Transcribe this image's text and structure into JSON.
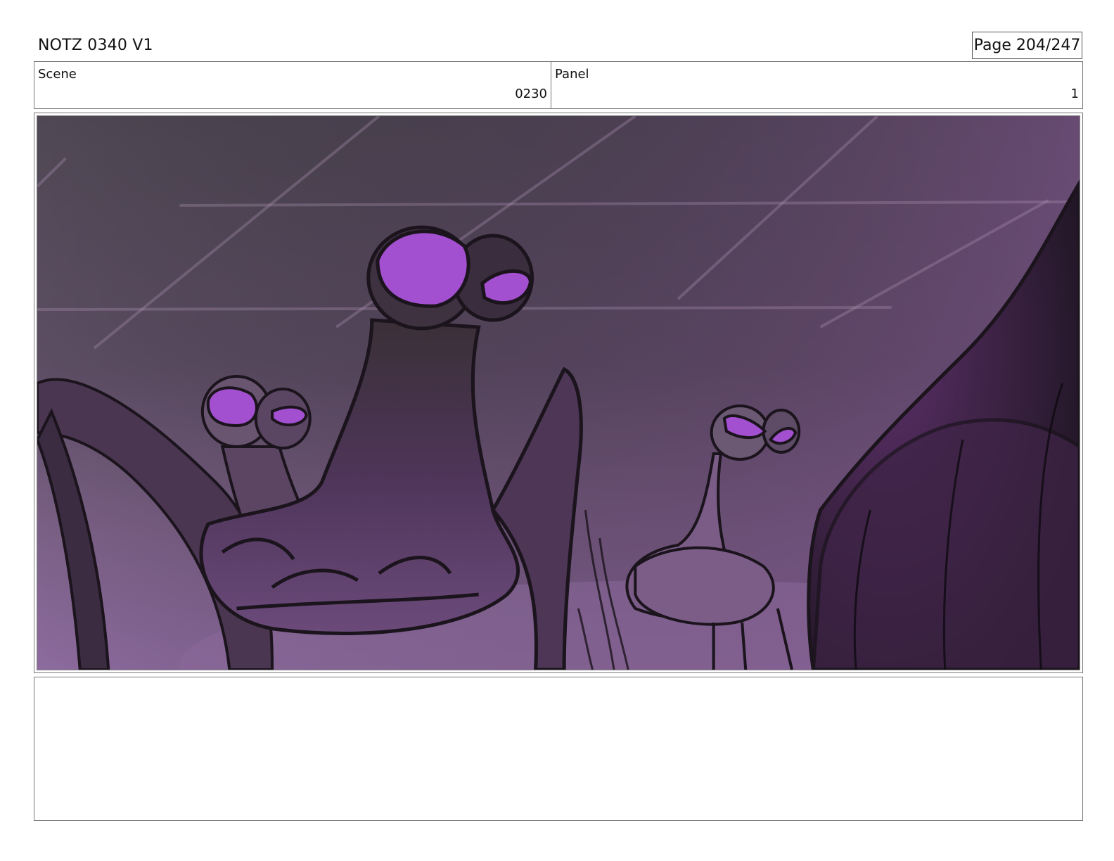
{
  "header": {
    "title": "NOTZ 0340 V1",
    "page": "Page 204/247"
  },
  "info": {
    "scene_label": "Scene",
    "scene_value": "0230",
    "panel_label": "Panel",
    "panel_value": "1"
  },
  "artwork": {
    "description_icon": "storyboard-frame",
    "colors": {
      "sky_top": "#4e4753",
      "sky_mid": "#5e4a66",
      "haze": "#8a6a9a",
      "eye": "#a24fd0",
      "ink": "#1b141d",
      "body_dark": "#3a2a40"
    }
  },
  "notes": {
    "text": ""
  }
}
